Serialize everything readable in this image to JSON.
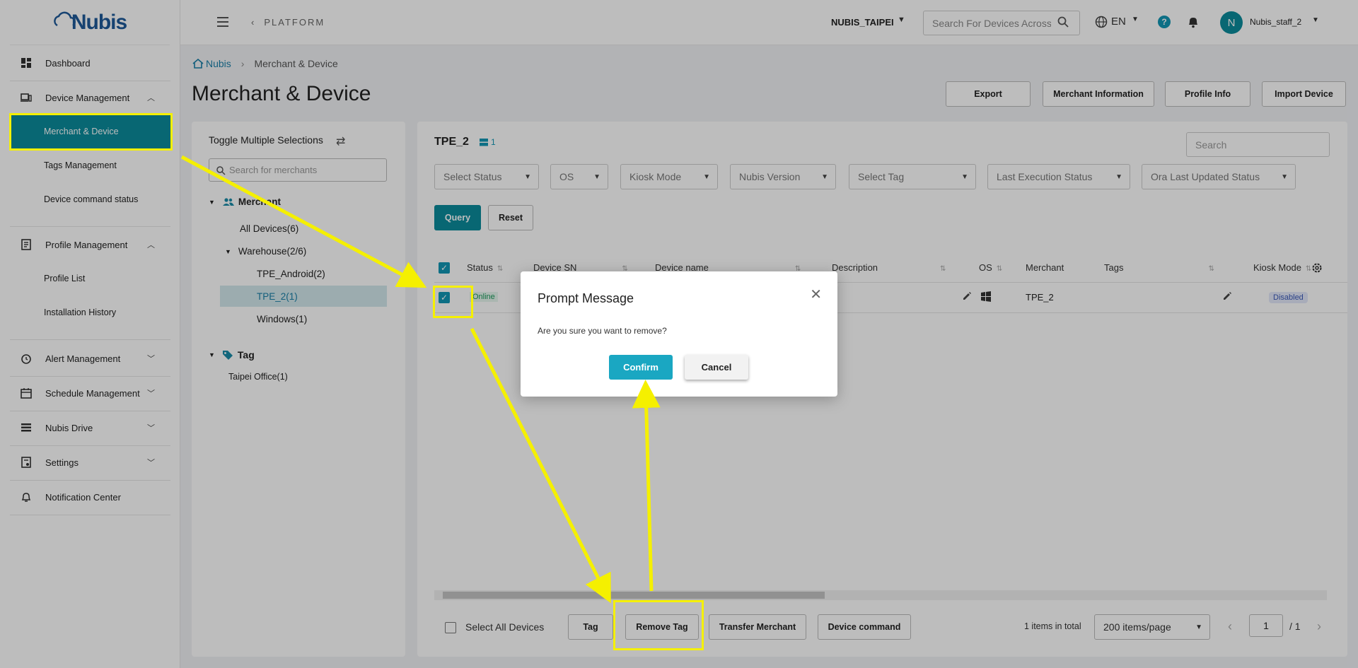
{
  "app": {
    "logo": "Nubis"
  },
  "sidebar": {
    "items": [
      {
        "label": "Dashboard"
      },
      {
        "label": "Device Management"
      },
      {
        "label": "Merchant & Device"
      },
      {
        "label": "Tags Management"
      },
      {
        "label": "Device command status"
      },
      {
        "label": "Profile Management"
      },
      {
        "label": "Profile List"
      },
      {
        "label": "Installation History"
      },
      {
        "label": "Alert Management"
      },
      {
        "label": "Schedule Management"
      },
      {
        "label": "Nubis Drive"
      },
      {
        "label": "Settings"
      },
      {
        "label": "Notification Center"
      }
    ]
  },
  "topbar": {
    "platform": "PLATFORM",
    "org": "NUBIS_TAIPEI",
    "search_placeholder": "Search For Devices Across",
    "lang": "EN",
    "avatar_initial": "N",
    "username": "Nubis_staff_2"
  },
  "page": {
    "breadcrumb_home": "Nubis",
    "breadcrumb_current": "Merchant & Device",
    "title": "Merchant & Device",
    "buttons": {
      "export": "Export",
      "merchant_info": "Merchant Information",
      "profile_info": "Profile Info",
      "import_device": "Import Device"
    }
  },
  "left_panel": {
    "toggle_label": "Toggle Multiple Selections",
    "search_placeholder": "Search for merchants",
    "merchant_header": "Merchant",
    "all_devices": "All Devices(6)",
    "warehouse": "Warehouse(2/6)",
    "tpe_android": "TPE_Android(2)",
    "tpe_2": "TPE_2(1)",
    "windows": "Windows(1)",
    "tag_header": "Tag",
    "taipei_office": "Taipei Office(1)"
  },
  "right_panel": {
    "group_title": "TPE_2",
    "group_count": "1",
    "search_placeholder": "Search",
    "filters": {
      "status": "Select Status",
      "os": "OS",
      "kiosk": "Kiosk Mode",
      "version": "Nubis Version",
      "tag": "Select Tag",
      "last_exec": "Last Execution Status",
      "ora": "Ora Last Updated Status"
    },
    "query": "Query",
    "reset": "Reset",
    "columns": {
      "status": "Status",
      "sn": "Device SN",
      "name": "Device name",
      "description": "Description",
      "os": "OS",
      "merchant": "Merchant",
      "tags": "Tags",
      "kiosk": "Kiosk Mode"
    },
    "row": {
      "status": "Online",
      "merchant": "TPE_2",
      "kiosk": "Disabled"
    },
    "footer": {
      "select_all": "Select All Devices",
      "tag": "Tag",
      "remove_tag": "Remove Tag",
      "transfer_merchant": "Transfer Merchant",
      "device_command": "Device command",
      "total": "1 items in total",
      "per_page": "200 items/page",
      "page": "1",
      "page_total": "/ 1"
    }
  },
  "modal": {
    "title": "Prompt Message",
    "message": "Are you sure you want to remove?",
    "confirm": "Confirm",
    "cancel": "Cancel"
  },
  "colors": {
    "accent": "#0c8b9b",
    "confirm": "#1aa7c2",
    "annotation": "#f5f000"
  }
}
